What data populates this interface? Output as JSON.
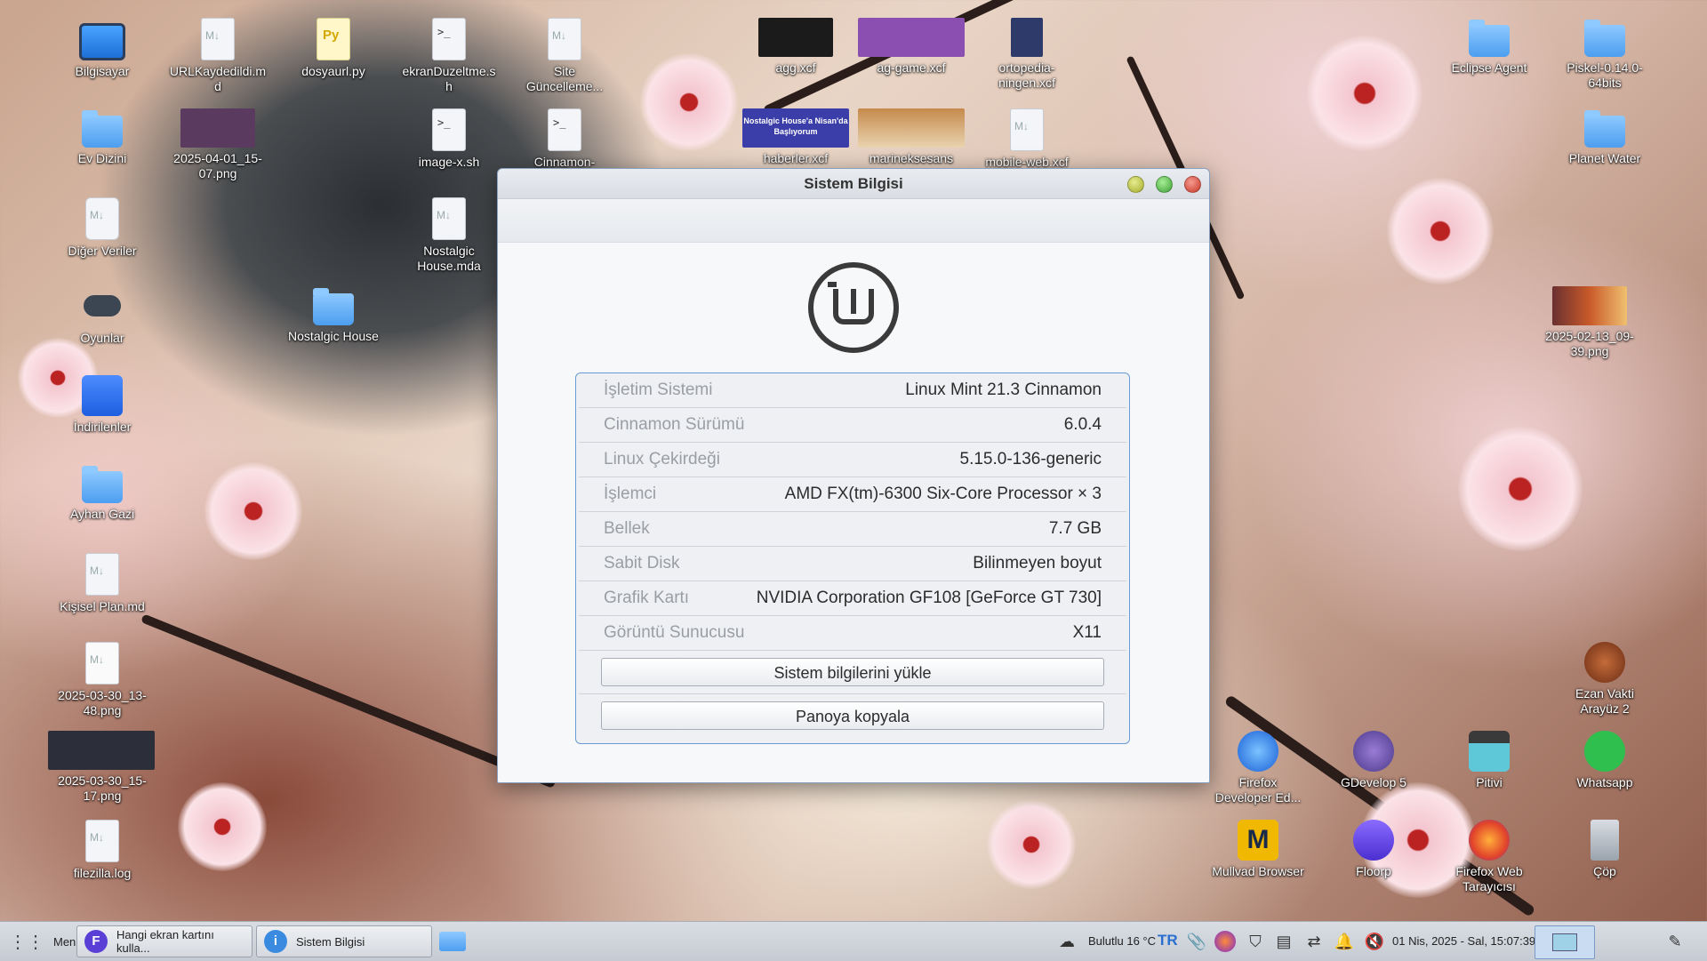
{
  "desktop": {
    "left_icons": [
      {
        "label": "Bilgisayar",
        "icon": "computer-icon"
      },
      {
        "label": "Ev Dizini",
        "icon": "home-folder-icon"
      },
      {
        "label": "Diğer Veriler",
        "icon": "drive-icon"
      },
      {
        "label": "Oyunlar",
        "icon": "gamepad-icon"
      },
      {
        "label": "İndirilenler",
        "icon": "downloads-folder-icon"
      },
      {
        "label": "Ayhan Gazi",
        "icon": "folder-icon"
      },
      {
        "label": "Kişisel Plan.md",
        "icon": "markdown-file-icon"
      },
      {
        "label": "2025-03-30_13-48.png",
        "icon": "image-file-icon"
      },
      {
        "label": "2025-03-30_15-17.png",
        "icon": "image-file-icon"
      },
      {
        "label": "filezilla.log",
        "icon": "text-file-icon"
      }
    ],
    "col2_icons": [
      {
        "label": "URLKaydedildi.md",
        "icon": "markdown-file-icon"
      },
      {
        "label": "2025-04-01_15-07.png",
        "icon": "image-file-icon"
      }
    ],
    "col3_icons": [
      {
        "label": "dosyaurl.py",
        "icon": "python-file-icon"
      },
      {
        "label": "Nostalgic House",
        "icon": "folder-icon"
      }
    ],
    "col4_icons": [
      {
        "label": "ekranDuzeltme.sh",
        "icon": "script-file-icon"
      },
      {
        "label": "image-x.sh",
        "icon": "script-file-icon"
      },
      {
        "label": "Nostalgic House.mda",
        "icon": "text-file-icon"
      }
    ],
    "col5_icons": [
      {
        "label": "Site Güncelleme...",
        "icon": "markdown-file-icon"
      },
      {
        "label": "Cinnamon-",
        "icon": "script-file-icon"
      }
    ],
    "top_images": [
      {
        "label": "agg.xcf",
        "icon": "image-file-icon"
      },
      {
        "label": "ag-game.xcf",
        "icon": "image-file-icon"
      },
      {
        "label": "ortopedia-ningen.xcf",
        "icon": "image-file-icon"
      },
      {
        "label": "haberler.xcf",
        "icon": "image-file-icon",
        "thumb_text": "Nostalgic House'a Nisan'da Başlıyorum"
      },
      {
        "label": "marineksesans",
        "icon": "image-file-icon"
      },
      {
        "label": "mobile-web.xcf",
        "icon": "gimp-icon"
      }
    ],
    "right_icons": [
      {
        "label": "Eclipse Agent",
        "icon": "folder-icon"
      },
      {
        "label": "Piskel-0.14.0-64bits",
        "icon": "folder-icon"
      },
      {
        "label": "Planet Water",
        "icon": "folder-icon"
      },
      {
        "label": "2025-02-13_09-39.png",
        "icon": "image-file-icon"
      },
      {
        "label": "Ezan Vakti Arayüz 2",
        "icon": "app-icon"
      },
      {
        "label": "Firefox Developer Ed...",
        "icon": "firefox-dev-icon"
      },
      {
        "label": "GDevelop 5",
        "icon": "gdevelop-icon"
      },
      {
        "label": "Pitivi",
        "icon": "pitivi-icon"
      },
      {
        "label": "Whatsapp",
        "icon": "whatsapp-icon"
      },
      {
        "label": "Mullvad Browser",
        "icon": "mullvad-icon"
      },
      {
        "label": "Floorp",
        "icon": "floorp-icon"
      },
      {
        "label": "Firefox Web Tarayıcısı",
        "icon": "firefox-icon"
      },
      {
        "label": "Çöp",
        "icon": "trash-icon"
      }
    ]
  },
  "window": {
    "title": "Sistem Bilgisi",
    "rows": [
      {
        "key": "İşletim Sistemi",
        "value": "Linux Mint 21.3 Cinnamon"
      },
      {
        "key": "Cinnamon Sürümü",
        "value": "6.0.4"
      },
      {
        "key": "Linux Çekirdeği",
        "value": "5.15.0-136-generic"
      },
      {
        "key": "İşlemci",
        "value": "AMD FX(tm)-6300 Six-Core Processor × 3"
      },
      {
        "key": "Bellek",
        "value": "7.7 GB"
      },
      {
        "key": "Sabit Disk",
        "value": "Bilinmeyen boyut"
      },
      {
        "key": "Grafik Kartı",
        "value": "NVIDIA Corporation GF108 [GeForce GT 730]"
      },
      {
        "key": "Görüntü Sunucusu",
        "value": "X11"
      }
    ],
    "upload_button": "Sistem bilgilerini yükle",
    "copy_button": "Panoya kopyala"
  },
  "taskbar": {
    "menu_label": "Menu",
    "tasks": [
      {
        "label": "Hangi ekran kartını kulla..."
      },
      {
        "label": "Sistem Bilgisi"
      }
    ],
    "weather": "Bulutlu 16 °C",
    "keyboard_layout": "TR",
    "clock": "01 Nis, 2025 - Sal, 15:07:39"
  },
  "colors": {
    "accent_border": "#6b9ad6",
    "close": "#c73826",
    "minimize": "#a6ad2c",
    "maximize": "#3f9f37"
  }
}
